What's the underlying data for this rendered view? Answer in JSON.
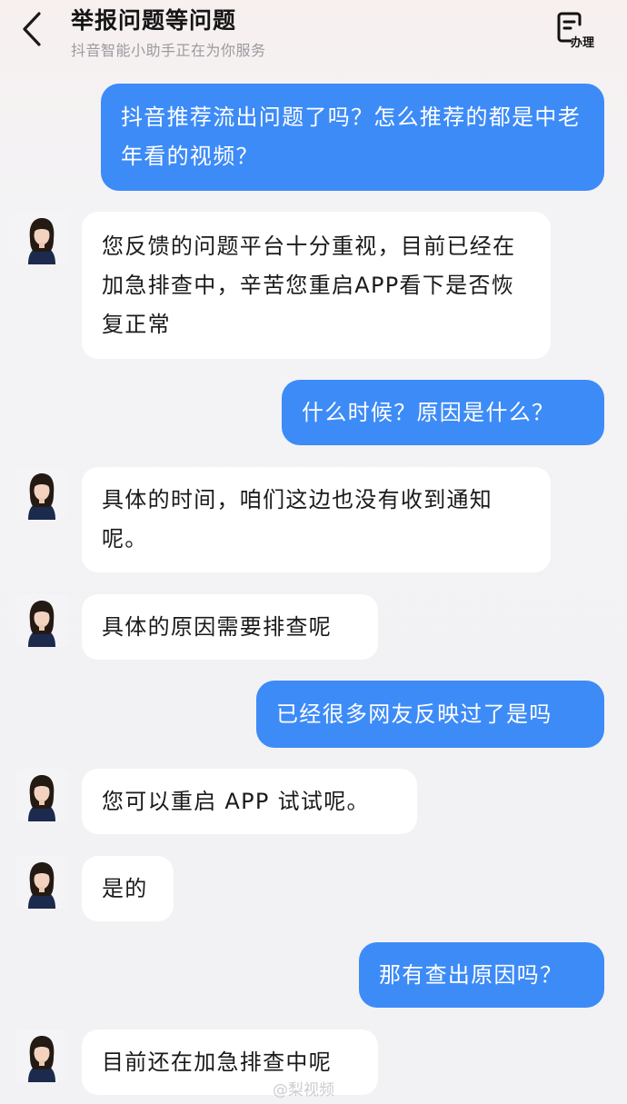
{
  "header": {
    "title": "举报问题等问题",
    "subtitle": "抖音智能小助手正在为你服务",
    "back_icon": "chevron-left-icon",
    "action_label": "办理",
    "action_icon": "document-icon"
  },
  "messages": [
    {
      "role": "user",
      "text": "抖音推荐流出问题了吗？怎么推荐的都是中老年看的视频？"
    },
    {
      "role": "bot",
      "text": "您反馈的问题平台十分重视，目前已经在加急排查中，辛苦您重启APP看下是否恢复正常"
    },
    {
      "role": "user",
      "text": "什么时候？原因是什么？"
    },
    {
      "role": "bot",
      "text": "具体的时间，咱们这边也没有收到通知呢。"
    },
    {
      "role": "bot",
      "text": "具体的原因需要排查呢"
    },
    {
      "role": "user",
      "text": "已经很多网友反映过了是吗"
    },
    {
      "role": "bot",
      "text": "您可以重启 APP 试试呢。"
    },
    {
      "role": "bot",
      "text": "是的"
    },
    {
      "role": "user",
      "text": "那有查出原因吗？"
    },
    {
      "role": "bot",
      "text": "目前还在加急排查中呢"
    }
  ],
  "watermark": "@梨视频",
  "colors": {
    "user_bubble": "#3d8bf7",
    "bot_bubble": "#ffffff",
    "background": "#f2f2f4"
  }
}
